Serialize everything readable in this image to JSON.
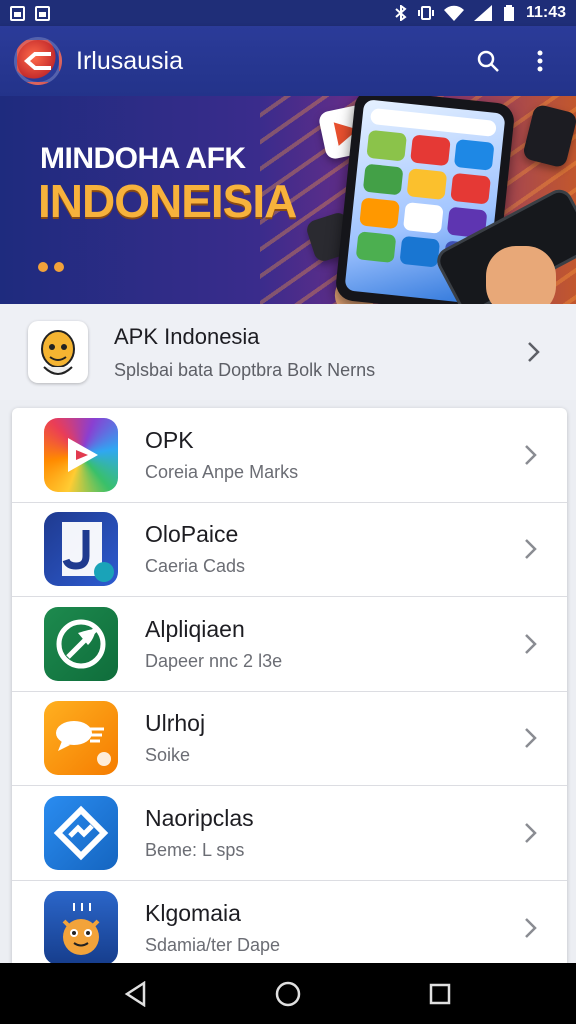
{
  "status_bar": {
    "time": "11:43",
    "icons": [
      "gallery-icon",
      "image-icon",
      "bluetooth-icon",
      "vibrate-icon",
      "wifi-icon",
      "signal-icon",
      "battery-icon"
    ]
  },
  "app_bar": {
    "title": "Irlusausia",
    "actions": [
      "search-icon",
      "more-vert-icon"
    ]
  },
  "banner": {
    "line1": "MINDOHA AFK",
    "line2": "INDONEISIA",
    "accent_color": "#f7b23c"
  },
  "featured": {
    "title": "APK Indonesia",
    "subtitle": "Splsbai bata Doptbra Bolk Nerns"
  },
  "apps": [
    {
      "title": "OPK",
      "subtitle": "Coreia Anpe Marks",
      "icon": "play-triangle-icon"
    },
    {
      "title": "OloPaice",
      "subtitle": "Caeria Cads",
      "icon": "j-letter-icon"
    },
    {
      "title": "Alpliqiaen",
      "subtitle": "Dapeer nnc 2 l3e",
      "icon": "leaf-icon"
    },
    {
      "title": "Ulrhoj",
      "subtitle": "Soike",
      "icon": "chat-bubble-icon"
    },
    {
      "title": "Naoripclas",
      "subtitle": "Beme: L sps",
      "icon": "diamond-logo-icon"
    },
    {
      "title": "Klgomaia",
      "subtitle": "Sdamia/ter Dape",
      "icon": "cartoon-character-icon"
    }
  ],
  "nav": [
    "back-icon",
    "home-icon",
    "recents-icon"
  ]
}
